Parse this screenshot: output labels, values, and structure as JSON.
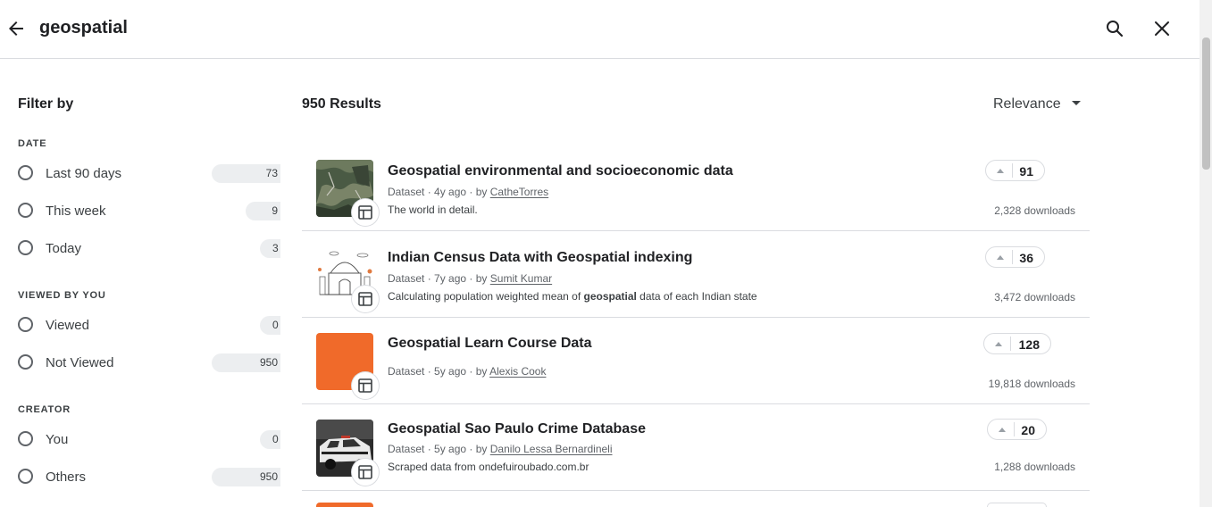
{
  "header": {
    "query": "geospatial"
  },
  "filters": {
    "title": "Filter by",
    "sections": [
      {
        "label": "DATE",
        "options": [
          {
            "label": "Last 90 days",
            "count": "73"
          },
          {
            "label": "This week",
            "count": "9"
          },
          {
            "label": "Today",
            "count": "3"
          }
        ]
      },
      {
        "label": "VIEWED BY YOU",
        "options": [
          {
            "label": "Viewed",
            "count": "0"
          },
          {
            "label": "Not Viewed",
            "count": "950"
          }
        ]
      },
      {
        "label": "CREATOR",
        "options": [
          {
            "label": "You",
            "count": "0"
          },
          {
            "label": "Others",
            "count": "950"
          }
        ]
      }
    ]
  },
  "results": {
    "count_label": "950 Results",
    "sort_label": "Relevance",
    "items": [
      {
        "title": "Geospatial environmental and socioeconomic data",
        "type": "Dataset",
        "age": "4y ago",
        "by": "by",
        "author": "CatheTorres",
        "description": "The world in detail.",
        "votes": "91",
        "downloads": "2,328 downloads",
        "thumb_icon": "satellite-map-thumbnail"
      },
      {
        "title": "Indian Census Data with Geospatial indexing",
        "type": "Dataset",
        "age": "7y ago",
        "by": "by",
        "author": "Sumit Kumar",
        "description_prefix": "Calculating population weighted mean of ",
        "description_bold": "geospatial",
        "description_suffix": " data of each Indian state",
        "votes": "36",
        "downloads": "3,472 downloads",
        "thumb_icon": "india-landmarks-thumbnail"
      },
      {
        "title": "Geospatial Learn Course Data",
        "type": "Dataset",
        "age": "5y ago",
        "by": "by",
        "author": "Alexis Cook",
        "description": "",
        "votes": "128",
        "downloads": "19,818 downloads",
        "thumb_icon": "orange-thumbnail"
      },
      {
        "title": "Geospatial Sao Paulo Crime Database",
        "type": "Dataset",
        "age": "5y ago",
        "by": "by",
        "author": "Danilo Lessa Bernardineli",
        "description": "Scraped data from ondefuiroubado.com.br",
        "votes": "20",
        "downloads": "1,288 downloads",
        "thumb_icon": "police-car-thumbnail"
      }
    ]
  },
  "colors": {
    "accent_orange": "#f06a2a",
    "text_primary": "#202124",
    "divider": "#dadce0"
  }
}
